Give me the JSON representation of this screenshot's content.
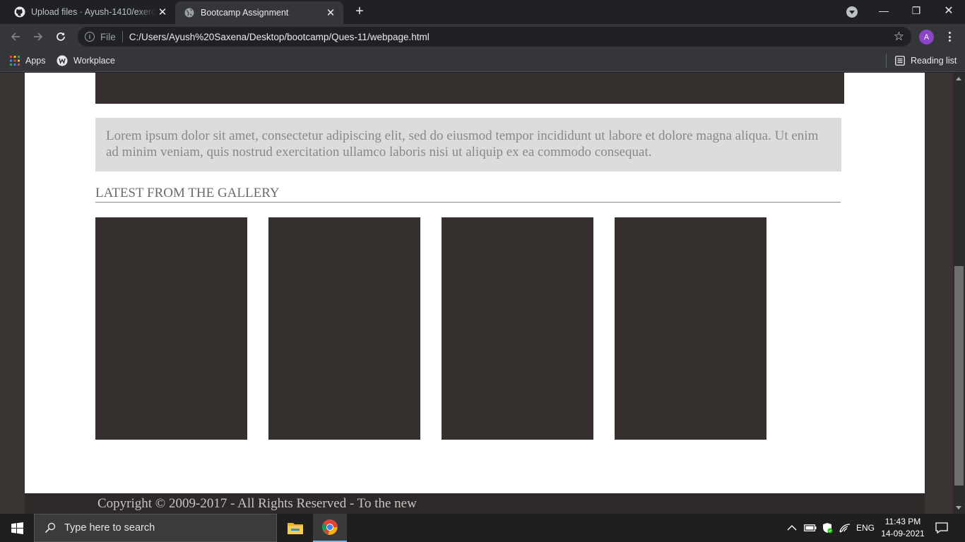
{
  "browser": {
    "tabs": [
      {
        "title": "Upload files · Ayush-1410/exercises",
        "favicon": "github-icon",
        "active": false
      },
      {
        "title": "Bootcamp Assignment",
        "favicon": "globe-icon",
        "active": true
      }
    ],
    "address_bar": {
      "scheme_label": "File",
      "url": "C:/Users/Ayush%20Saxena/Desktop/bootcamp/Ques-11/webpage.html"
    },
    "profile_initial": "A",
    "bookmarks": [
      {
        "label": "Apps",
        "icon": "apps-grid-icon"
      },
      {
        "label": "Workplace",
        "icon": "workplace-icon"
      }
    ],
    "reading_list_label": "Reading list"
  },
  "page": {
    "intro_text": "Lorem ipsum dolor sit amet, consectetur adipiscing elit, sed do eiusmod tempor incididunt ut labore et dolore magna aliqua. Ut enim ad minim veniam, quis nostrud exercitation ullamco laboris nisi ut aliquip ex ea commodo consequat.",
    "gallery_heading": "LATEST FROM THE GALLERY",
    "footer_text": "Copyright © 2009-2017 - All Rights Reserved - To the new"
  },
  "taskbar": {
    "search_placeholder": "Type here to search",
    "language": "ENG",
    "time": "11:43 PM",
    "date": "14-09-2021"
  },
  "colors": {
    "browser_bg": "#202124",
    "toolbar_bg": "#35363a",
    "page_dark": "#352f2e",
    "lorem_bg": "#dcdcdc",
    "lorem_text": "#8c8888"
  }
}
